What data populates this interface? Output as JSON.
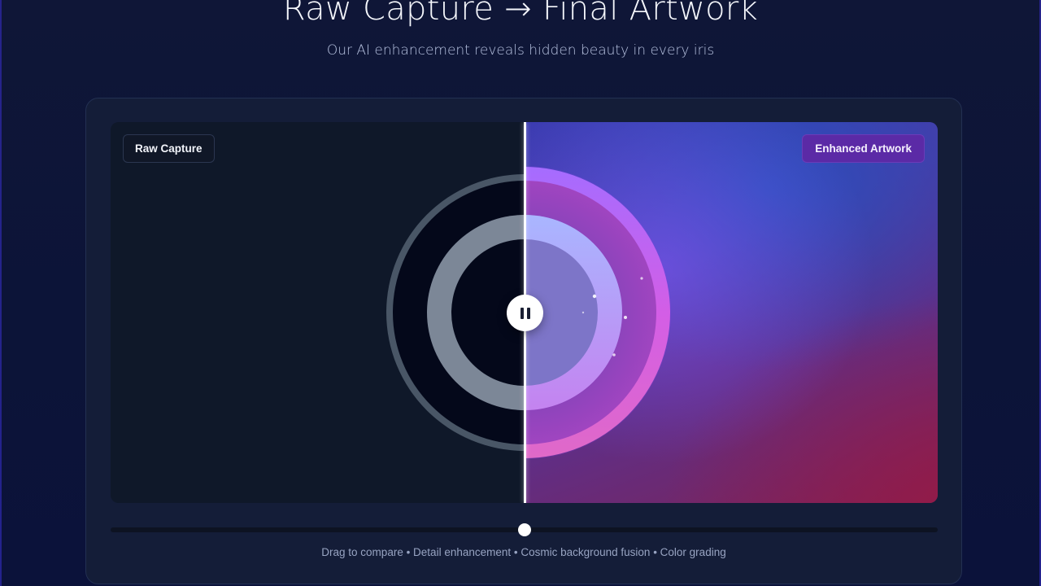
{
  "hero": {
    "title": "Raw Capture → Final Artwork",
    "subtitle": "Our AI enhancement reveals hidden beauty in every iris"
  },
  "viewer": {
    "raw_label": "Raw Capture",
    "enhanced_label": "Enhanced Artwork",
    "play_state_icon": "pause-icon",
    "comparison_position": 0.5
  },
  "slider": {
    "value": 0.5
  },
  "caption": "Drag to compare • Detail enhancement • Cosmic background fusion • Color grading",
  "colors": {
    "background": "#0f1637",
    "card": "#141d38",
    "accent_purple": "#5b2aa6",
    "raw_background": "#0f1829"
  }
}
